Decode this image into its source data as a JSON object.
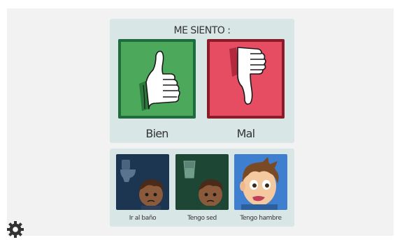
{
  "title": "ME SIENTO :",
  "feelings": [
    {
      "label": "Bien",
      "icon": "thumbs-up-icon",
      "color": "#4ca95c",
      "border": "#1f6b3d"
    },
    {
      "label": "Mal",
      "icon": "thumbs-down-icon",
      "color": "#e64d62",
      "border": "#8a1c2a"
    }
  ],
  "needs": [
    {
      "label": "Ir al baño",
      "icon": "toilet-boy-icon",
      "color": "#1c3550"
    },
    {
      "label": "Tengo sed",
      "icon": "water-glass-boy-icon",
      "color": "#1d4634"
    },
    {
      "label": "Tengo hambre",
      "icon": "hungry-boy-icon",
      "color": "#3e7fd0"
    }
  ],
  "settings": {
    "icon": "gear-icon"
  }
}
